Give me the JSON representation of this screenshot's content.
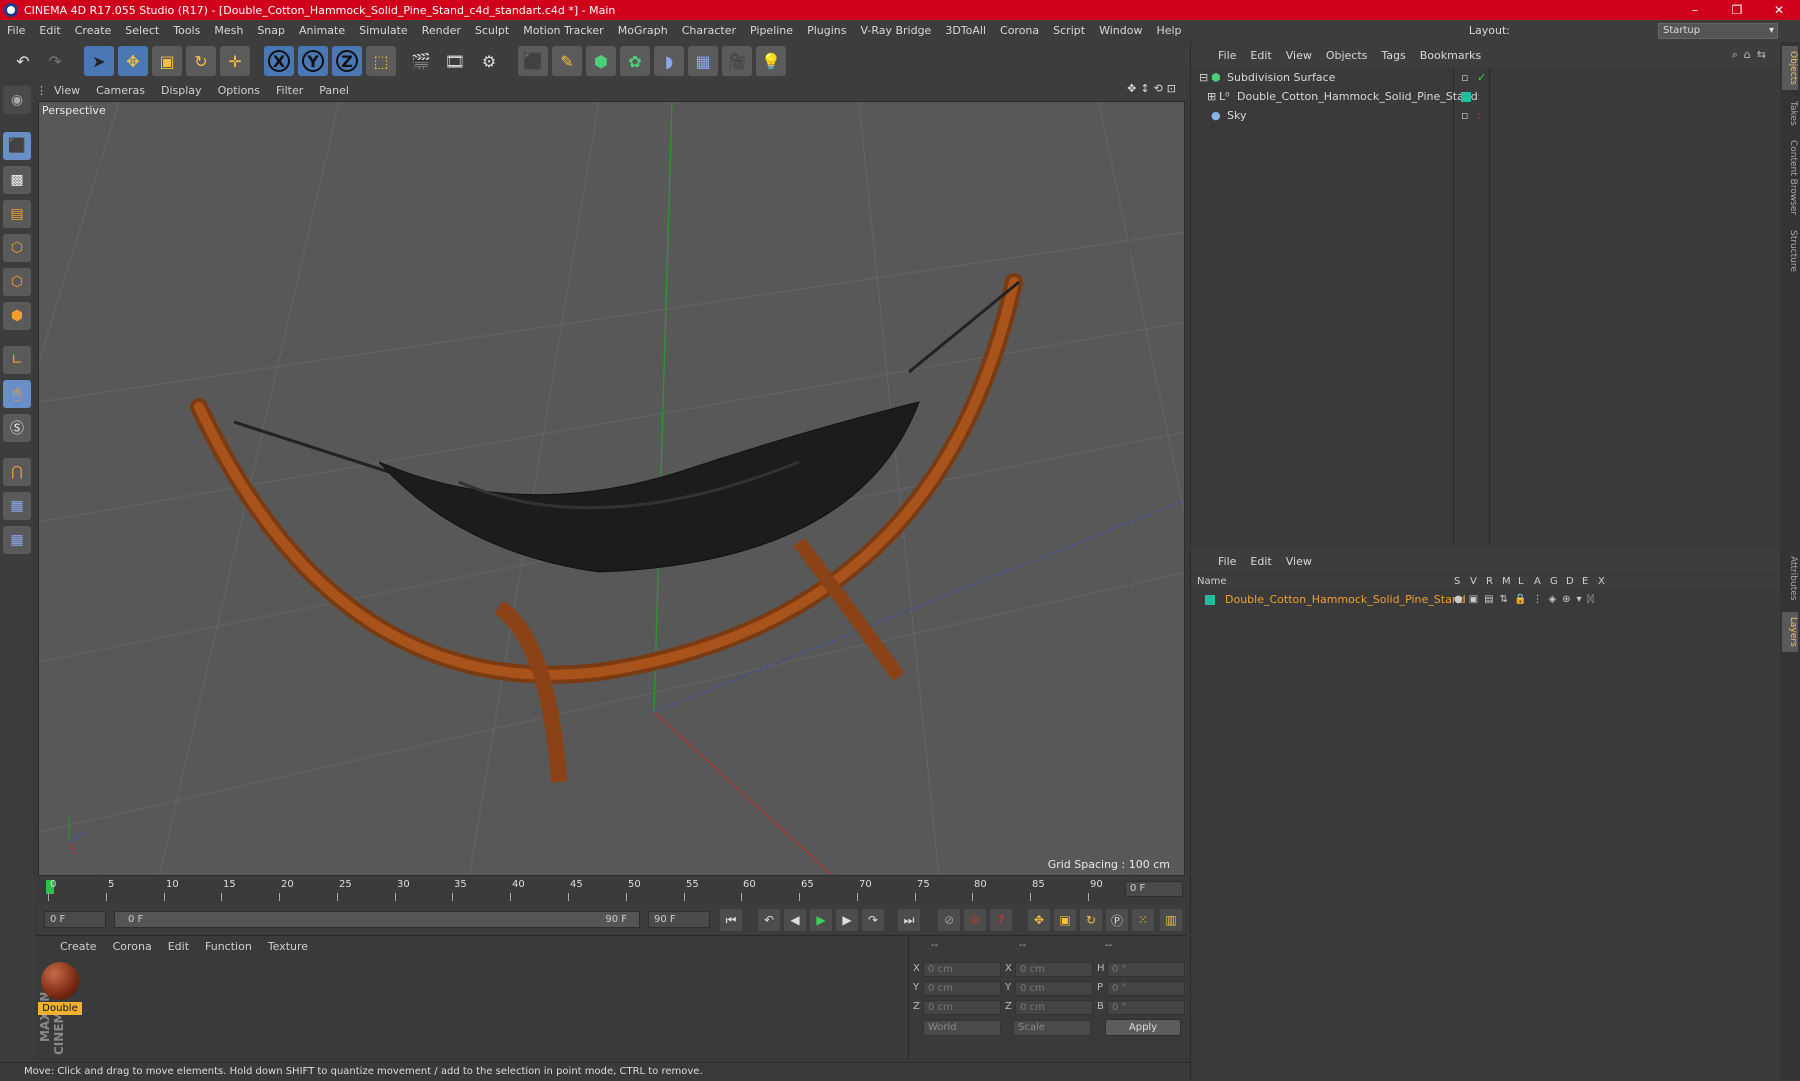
{
  "window": {
    "title": "CINEMA 4D R17.055 Studio (R17) - [Double_Cotton_Hammock_Solid_Pine_Stand_c4d_standart.c4d *] - Main",
    "controls": [
      "–",
      "❐",
      "✕"
    ]
  },
  "menubar": {
    "items": [
      "File",
      "Edit",
      "Create",
      "Select",
      "Tools",
      "Mesh",
      "Snap",
      "Animate",
      "Simulate",
      "Render",
      "Sculpt",
      "Motion Tracker",
      "MoGraph",
      "Character",
      "Pipeline",
      "Plugins",
      "V-Ray Bridge",
      "3DToAll",
      "Corona",
      "Script",
      "Window",
      "Help"
    ],
    "layout_label": "Layout:",
    "layout_value": "Startup"
  },
  "toolbar": {
    "axis_x": "X",
    "axis_y": "Y",
    "axis_z": "Z"
  },
  "viewport": {
    "menu": [
      "View",
      "Cameras",
      "Display",
      "Options",
      "Filter",
      "Panel"
    ],
    "label": "Perspective",
    "grid_spacing": "Grid Spacing : 100 cm"
  },
  "timeline": {
    "ticks": [
      "0",
      "5",
      "10",
      "15",
      "20",
      "25",
      "30",
      "35",
      "40",
      "45",
      "50",
      "55",
      "60",
      "65",
      "70",
      "75",
      "80",
      "85",
      "90"
    ],
    "current_frame": "0 F"
  },
  "playback": {
    "start": "0 F",
    "slider_start": "0 F",
    "slider_end": "90 F",
    "end": "90 F"
  },
  "material_panel": {
    "menu": [
      "Create",
      "Corona",
      "Edit",
      "Function",
      "Texture"
    ],
    "material_name": "Double",
    "logo": "MAXON CINEMA 4D"
  },
  "coord_panel": {
    "headers": [
      "--",
      "--",
      "--"
    ],
    "rows": [
      {
        "l1": "X",
        "v1": "0 cm",
        "l2": "X",
        "v2": "0 cm",
        "l3": "H",
        "v3": "0 °"
      },
      {
        "l1": "Y",
        "v1": "0 cm",
        "l2": "Y",
        "v2": "0 cm",
        "l3": "P",
        "v3": "0 °"
      },
      {
        "l1": "Z",
        "v1": "0 cm",
        "l2": "Z",
        "v2": "0 cm",
        "l3": "B",
        "v3": "0 °"
      }
    ],
    "coord_system": "World",
    "mode": "Scale",
    "apply": "Apply"
  },
  "status_text": "Move: Click and drag to move elements. Hold down SHIFT to quantize movement / add to the selection in point mode, CTRL to remove.",
  "objects_panel": {
    "menu": [
      "File",
      "Edit",
      "View",
      "Objects",
      "Tags",
      "Bookmarks"
    ],
    "items": [
      {
        "name": "Subdivision Surface"
      },
      {
        "name": "Double_Cotton_Hammock_Solid_Pine_Stand"
      },
      {
        "name": "Sky"
      }
    ]
  },
  "layers_panel": {
    "menu": [
      "File",
      "Edit",
      "View"
    ],
    "col_name": "Name",
    "columns": [
      "S",
      "V",
      "R",
      "M",
      "L",
      "A",
      "G",
      "D",
      "E",
      "X"
    ],
    "layer_name": "Double_Cotton_Hammock_Solid_Pine_Stand"
  },
  "right_tabs": [
    "Objects",
    "Takes",
    "Content Browser",
    "Structure",
    "Attributes",
    "Layers"
  ],
  "colors": {
    "title_bar": "#d0021b",
    "accent_blue": "#4a78b5",
    "layer_orange": "#f0a030",
    "layer_teal": "#1dbf9f"
  }
}
